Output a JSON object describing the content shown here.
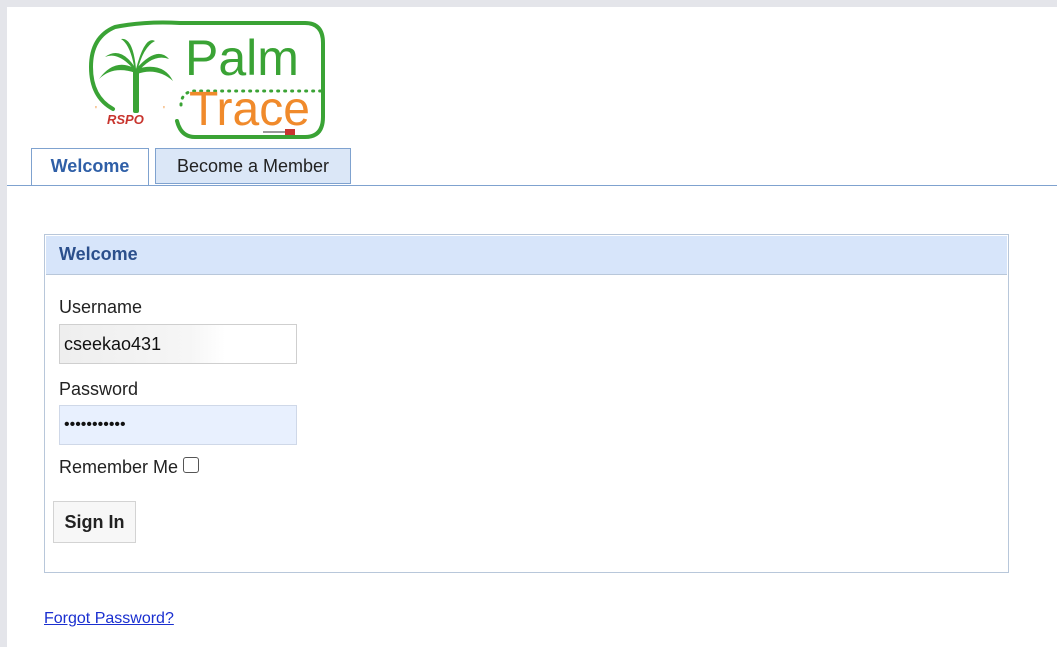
{
  "logo": {
    "brand_word_1": "Palm",
    "brand_word_2": "Trace",
    "seal_text": "RSPO",
    "colors": {
      "green": "#3aa335",
      "orange": "#f08a2b",
      "red": "#c8352e"
    }
  },
  "tabs": [
    {
      "label": "Welcome",
      "active": true
    },
    {
      "label": "Become a Member",
      "active": false
    }
  ],
  "login_panel": {
    "title": "Welcome",
    "username_label": "Username",
    "username_value": "cseekao431",
    "password_label": "Password",
    "password_value": "•••••••••••",
    "remember_label": "Remember Me",
    "remember_checked": false,
    "signin_label": "Sign In"
  },
  "forgot_password_link": "Forgot Password?"
}
